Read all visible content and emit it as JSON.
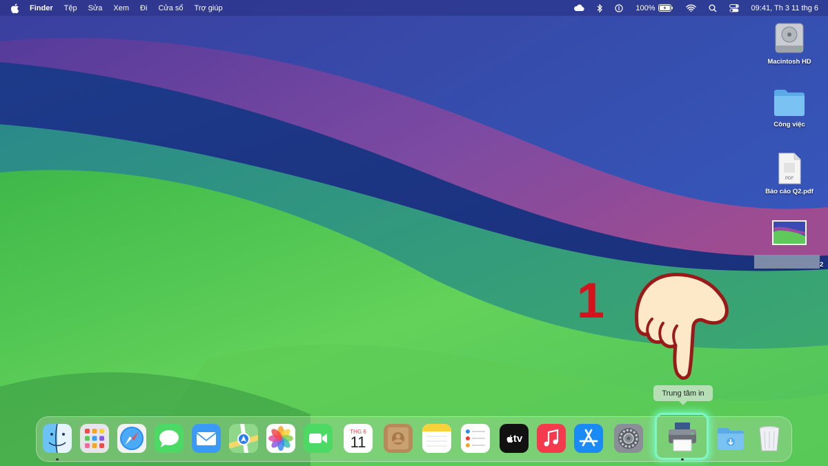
{
  "menubar": {
    "app_name": "Finder",
    "menus": [
      "Tệp",
      "Sửa",
      "Xem",
      "Đi",
      "Cửa sổ",
      "Trợ giúp"
    ],
    "battery": "100%",
    "clock": "09:41, Th 3 11 thg 6",
    "status_icons": [
      "icloud-icon",
      "bluetooth-icon",
      "contrast-icon",
      "battery-icon",
      "wifi-icon",
      "search-icon",
      "control-center-icon"
    ]
  },
  "desktop": {
    "items": [
      {
        "label": "Macintosh HD",
        "icon": "hard-drive-icon"
      },
      {
        "label": "Công việc",
        "icon": "folder-icon"
      },
      {
        "label": "Báo cáo Q2.pdf",
        "icon": "pdf-file-icon",
        "badge": "PDF"
      },
      {
        "label": "2",
        "icon": "image-file-icon"
      }
    ]
  },
  "annotation": {
    "step": "1"
  },
  "tooltip": "Trung tâm in",
  "dock": {
    "calendar_month": "THG 6",
    "calendar_day": "11",
    "tv_label": "tv",
    "apps": [
      "Finder",
      "Launchpad",
      "Safari",
      "Messages",
      "Mail",
      "Maps",
      "Photos",
      "FaceTime",
      "Calendar",
      "Contacts",
      "Notes",
      "Reminders",
      "TV",
      "Music",
      "App Store",
      "System Settings",
      "Trung tâm in",
      "Downloads",
      "Trash"
    ]
  },
  "colors": {
    "menubar": "#283082",
    "highlight": "#7ff5c8",
    "step_number": "#d8121c"
  }
}
